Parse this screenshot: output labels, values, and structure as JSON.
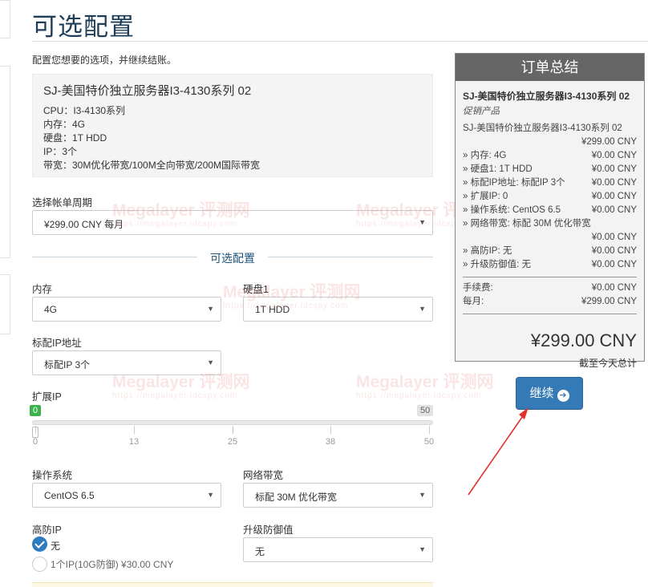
{
  "page": {
    "title": "可选配置",
    "intro": "配置您想要的选项，并继续结账。"
  },
  "product": {
    "name": "SJ-美国特价独立服务器I3-4130系列 02",
    "specs": [
      "CPU：I3-4130系列",
      "内存：4G",
      "硬盘：1T HDD",
      "IP：3个",
      "带宽：30M优化带宽/100M全向带宽/200M国际带宽"
    ]
  },
  "billing": {
    "label": "选择帐单周期",
    "value": "¥299.00 CNY 每月"
  },
  "config": {
    "section_title": "可选配置",
    "memory": {
      "label": "内存",
      "value": "4G"
    },
    "disk": {
      "label": "硬盘1",
      "value": "1T HDD"
    },
    "ip": {
      "label": "标配IP地址",
      "value": "标配IP 3个"
    },
    "extra_ip": {
      "label": "扩展IP",
      "current": "0",
      "max": "50",
      "fill_fraction": 0,
      "ticks": [
        "0",
        "13",
        "25",
        "38",
        "50"
      ]
    },
    "os": {
      "label": "操作系统",
      "value": "CentOS 6.5"
    },
    "bandwidth": {
      "label": "网络带宽",
      "value": "标配 30M 优化带宽"
    },
    "ddos": {
      "label": "高防IP",
      "options": [
        {
          "label": "无",
          "selected": true
        },
        {
          "label": "1个IP(10G防御) ¥30.00 CNY",
          "selected": false
        }
      ]
    },
    "upgrade_defense": {
      "label": "升级防御值",
      "value": "无"
    }
  },
  "summary": {
    "heading": "订单总结",
    "product_name": "SJ-美国特价独立服务器I3-4130系列 02",
    "product_group": "促销产品",
    "base_line": "SJ-美国特价独立服务器I3-4130系列 02",
    "base_price": "¥299.00 CNY",
    "items": [
      {
        "label": "» 内存: 4G",
        "price": "¥0.00 CNY"
      },
      {
        "label": "» 硬盘1: 1T HDD",
        "price": "¥0.00 CNY"
      },
      {
        "label": "» 标配IP地址: 标配IP 3个",
        "price": "¥0.00 CNY"
      },
      {
        "label": "» 扩展IP: 0",
        "price": "¥0.00 CNY"
      },
      {
        "label": "» 操作系统: CentOS 6.5",
        "price": "¥0.00 CNY"
      }
    ],
    "bandwidth_label": "» 网络带宽: 标配 30M 优化带宽",
    "bandwidth_price": "¥0.00 CNY",
    "items2": [
      {
        "label": "» 高防IP: 无",
        "price": "¥0.00 CNY"
      },
      {
        "label": "» 升级防御值: 无",
        "price": "¥0.00 CNY"
      }
    ],
    "fee_label": "手续费:",
    "fee_value": "¥0.00 CNY",
    "monthly_label": "每月:",
    "monthly_value": "¥299.00 CNY",
    "total": "¥299.00 CNY",
    "total_note": "截至今天总计"
  },
  "continue_button": {
    "label": "继续",
    "icon": "arrow-right-circle-icon"
  },
  "watermark": {
    "text": "Megalayer 评测网",
    "sub": "https://megalayer.idcspy.com"
  },
  "colors": {
    "title": "#1d3d59",
    "accent": "#337ab7",
    "slider": "#45a842",
    "arrow": "#e0312b"
  }
}
